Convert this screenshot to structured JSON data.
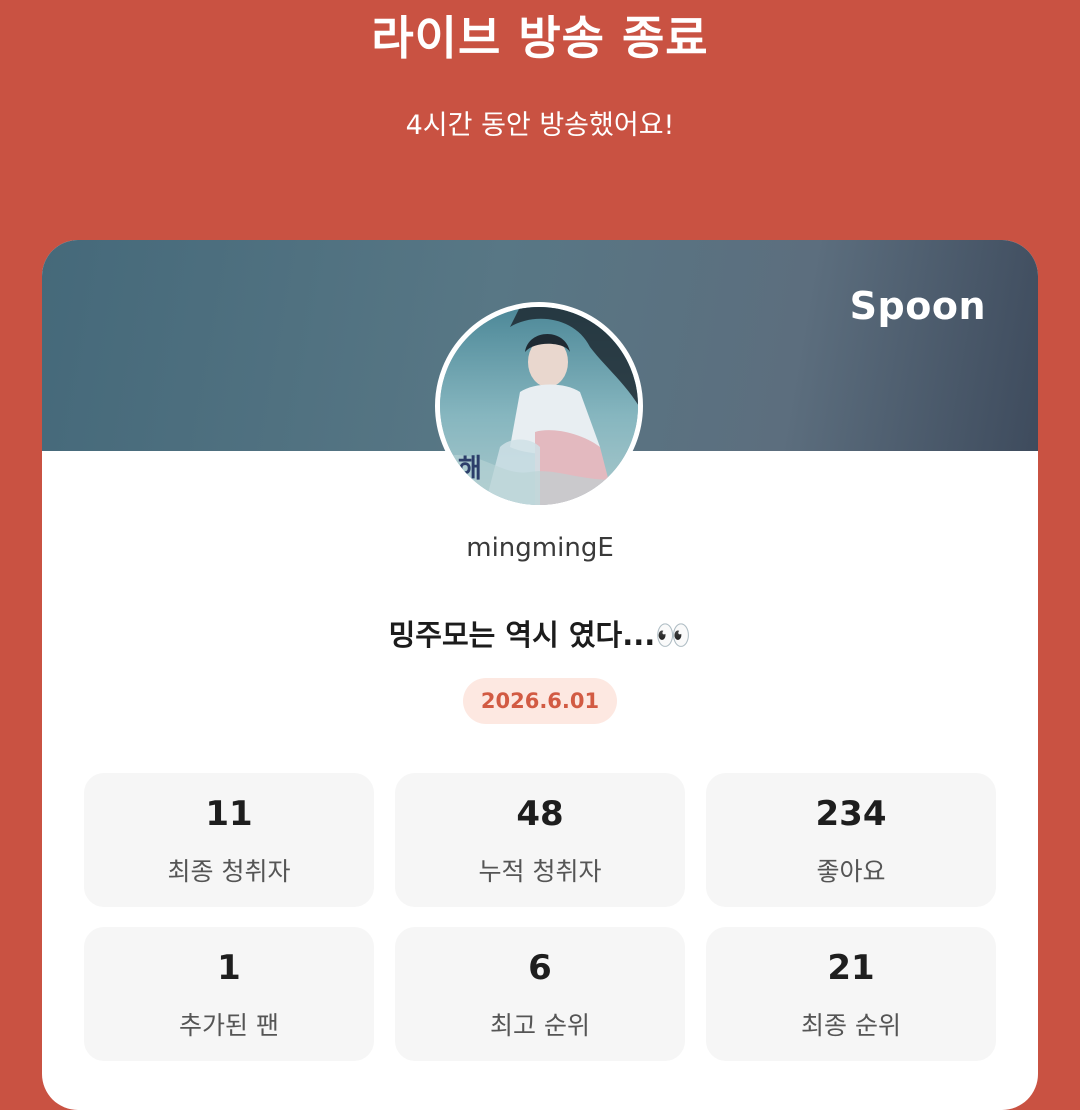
{
  "header": {
    "title": "라이브 방송 종료",
    "subtitle": "4시간 동안 방송했어요!"
  },
  "card": {
    "brand": "Spoon",
    "username": "mingmingE",
    "broadcast_title": "밍주모는 역시 였다...👀",
    "date": "2026.6.01"
  },
  "stats": [
    {
      "value": "11",
      "label": "최종 청취자"
    },
    {
      "value": "48",
      "label": "누적 청취자"
    },
    {
      "value": "234",
      "label": "좋아요"
    },
    {
      "value": "1",
      "label": "추가된 팬"
    },
    {
      "value": "6",
      "label": "최고 순위"
    },
    {
      "value": "21",
      "label": "최종 순위"
    }
  ],
  "avatar_caption": "해",
  "colors": {
    "background": "#c95242",
    "accent": "#d25b43",
    "badge_bg": "#fde8e1",
    "stat_bg": "#f6f6f6"
  }
}
